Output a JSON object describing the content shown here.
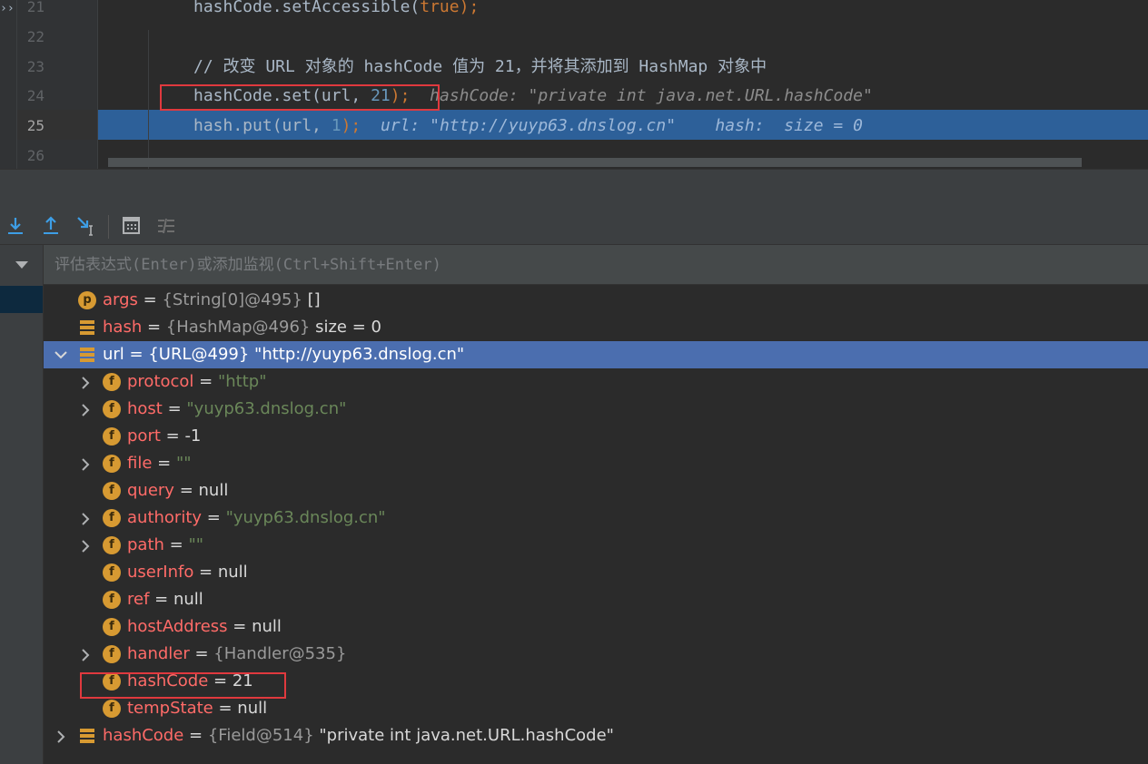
{
  "editor": {
    "more_glyph": "››",
    "lines": [
      {
        "num": "21",
        "code": "hashCode.setAccessible(",
        "kw": "true",
        "tail": ");"
      },
      {
        "num": "22"
      },
      {
        "num": "23",
        "comment": "// 改变 URL 对象的 hashCode 值为 21，并将其添加到 HashMap 对象中"
      },
      {
        "num": "24",
        "code": "hashCode.set(url, ",
        "n": "21",
        "tail": ");",
        "hint": "hashCode: \"private int java.net.URL.hashCode\""
      },
      {
        "num": "25",
        "code": "hash.put(url, ",
        "n": "1",
        "tail": ");",
        "hint": "url: \"http://yuyp63.dnslog.cn\"    hash:  size = 0"
      },
      {
        "num": "26"
      }
    ]
  },
  "toolbar": {
    "buttons": [
      "step-into-icon",
      "step-out-icon",
      "run-to-cursor-icon",
      "evaluate-expression-icon",
      "trace-stream-icon"
    ]
  },
  "eval": {
    "placeholder": "评估表达式(Enter)或添加监视(Ctrl+Shift+Enter)"
  },
  "variables": [
    {
      "name": "args",
      "eq": " = ",
      "type": "{String[0]@495}",
      "value": " []"
    },
    {
      "name": "hash",
      "eq": " = ",
      "type": "{HashMap@496}",
      "value": "  size = 0"
    },
    {
      "name": "url",
      "eq": " = ",
      "type": "{URL@499}",
      "value": " \"http://yuyp63.dnslog.cn\""
    },
    {
      "name": "protocol",
      "eq": " = ",
      "str": "\"http\""
    },
    {
      "name": "host",
      "eq": " = ",
      "str": "\"yuyp63.dnslog.cn\""
    },
    {
      "name": "port",
      "eq": " = ",
      "value": "-1"
    },
    {
      "name": "file",
      "eq": " = ",
      "str": "\"\""
    },
    {
      "name": "query",
      "eq": " = ",
      "value": "null"
    },
    {
      "name": "authority",
      "eq": " = ",
      "str": "\"yuyp63.dnslog.cn\""
    },
    {
      "name": "path",
      "eq": " = ",
      "str": "\"\""
    },
    {
      "name": "userInfo",
      "eq": " = ",
      "value": "null"
    },
    {
      "name": "ref",
      "eq": " = ",
      "value": "null"
    },
    {
      "name": "hostAddress",
      "eq": " = ",
      "value": "null"
    },
    {
      "name": "handler",
      "eq": " = ",
      "type": "{Handler@535}"
    },
    {
      "name": "hashCode",
      "eq": " = ",
      "value": "21"
    },
    {
      "name": "tempState",
      "eq": " = ",
      "value": "null"
    },
    {
      "name": "hashCode",
      "eq": " = ",
      "type": "{Field@514}",
      "value": " \"private int java.net.URL.hashCode\""
    }
  ],
  "icons": {
    "field": "f",
    "parameter": "p"
  },
  "colors": {
    "selection": "#4b6eaf",
    "exec_line": "#2d6099",
    "annotation_box": "#e0393e",
    "field_icon": "#d79a32"
  }
}
